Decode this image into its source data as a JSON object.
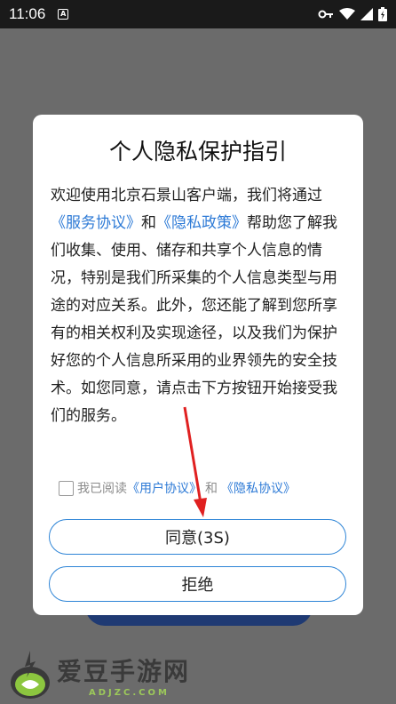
{
  "statusbar": {
    "time": "11:06"
  },
  "dialog": {
    "title": "个人隐私保护指引",
    "body": {
      "p1": "欢迎使用北京石景山客户端，我们将通过",
      "link1": "《服务协议》",
      "p2": "和",
      "link2": "《隐私政策》",
      "p3": "帮助您了解我们收集、使用、储存和共享个人信息的情况，特别是我们所采集的个人信息类型与用途的对应关系。此外，您还能了解到您所享有的相关权利及实现途径，以及我们为保护好您的个人信息所采用的业界领先的安全技术。如您同意，请点击下方按钮开始接受我们的服务。"
    },
    "agreement": {
      "prefix": "我已阅读",
      "link1": "《用户协议》",
      "and": "和",
      "link2": "《隐私协议》",
      "checked": false
    },
    "buttons": {
      "agree": "同意(3S)",
      "refuse": "拒绝"
    }
  },
  "colors": {
    "link": "#2d7ad6",
    "button_border": "#2d84d6",
    "annotation_arrow": "#e02020"
  },
  "watermark": {
    "title": "爱豆手游网",
    "subtitle": "ADJZC.COM"
  }
}
